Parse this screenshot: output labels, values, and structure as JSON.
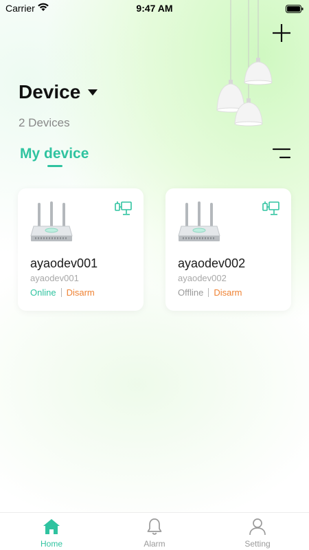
{
  "status_bar": {
    "carrier": "Carrier",
    "time": "9:47 AM"
  },
  "header": {
    "title": "Device",
    "device_count": "2 Devices"
  },
  "tabs": {
    "my_device": "My device"
  },
  "devices": [
    {
      "name": "ayaodev001",
      "id": "ayaodev001",
      "status": "Online",
      "mode": "Disarm",
      "online": true
    },
    {
      "name": "ayaodev002",
      "id": "ayaodev002",
      "status": "Offline",
      "mode": "Disarm",
      "online": false
    }
  ],
  "tabbar": {
    "items": [
      {
        "label": "Home",
        "icon": "home-icon",
        "active": true
      },
      {
        "label": "Alarm",
        "icon": "bell-icon",
        "active": false
      },
      {
        "label": "Setting",
        "icon": "person-icon",
        "active": false
      }
    ]
  },
  "colors": {
    "accent": "#2fc3a0",
    "disarm": "#ef8233",
    "muted": "#9a9a9a"
  }
}
